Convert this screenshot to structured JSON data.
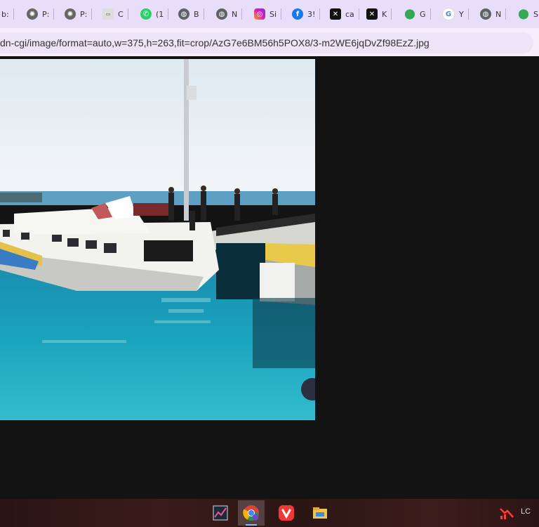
{
  "browser": {
    "tabs": [
      {
        "label": "b:",
        "icon": "page-icon",
        "color": "#9aa0a6"
      },
      {
        "label": "P:",
        "icon": "chatgpt-icon",
        "color": "#555555"
      },
      {
        "label": "P:",
        "icon": "chatgpt-icon",
        "color": "#555555"
      },
      {
        "label": "C",
        "icon": "site-thumbnail-icon",
        "color": "#dddddd"
      },
      {
        "label": "(1",
        "icon": "whatsapp-icon",
        "color": "#25d366"
      },
      {
        "label": "B",
        "icon": "globe-icon",
        "color": "#5f6368"
      },
      {
        "label": "N",
        "icon": "globe-icon",
        "color": "#5f6368"
      },
      {
        "label": "Si",
        "icon": "instagram-icon",
        "color": "#d6249f"
      },
      {
        "label": "3!",
        "icon": "facebook-icon",
        "color": "#1877f2"
      },
      {
        "label": "ca",
        "icon": "capcut-icon",
        "color": "#111111"
      },
      {
        "label": "K",
        "icon": "capcut-icon",
        "color": "#111111"
      },
      {
        "label": "G",
        "icon": "maps-pin-icon",
        "color": "#34a853"
      },
      {
        "label": "Y",
        "icon": "google-icon",
        "color": "#4285f4"
      },
      {
        "label": "N",
        "icon": "globe-icon",
        "color": "#5f6368"
      },
      {
        "label": "S",
        "icon": "maps-pin-icon",
        "color": "#34a853"
      }
    ],
    "url": "dn-cgi/image/format=auto,w=375,h=263,fit=crop/AzG7e6BM56h5POX8/3-m2WE6jqDvZf98EzZ.jpg",
    "accent": "#e9defa"
  },
  "taskbar": {
    "apps": [
      {
        "name": "stock-chart-app-icon",
        "active": false
      },
      {
        "name": "chrome-icon",
        "active": true
      },
      {
        "name": "vivaldi-icon",
        "active": false
      },
      {
        "name": "file-explorer-icon",
        "active": false
      }
    ],
    "tray_label": "LC"
  }
}
